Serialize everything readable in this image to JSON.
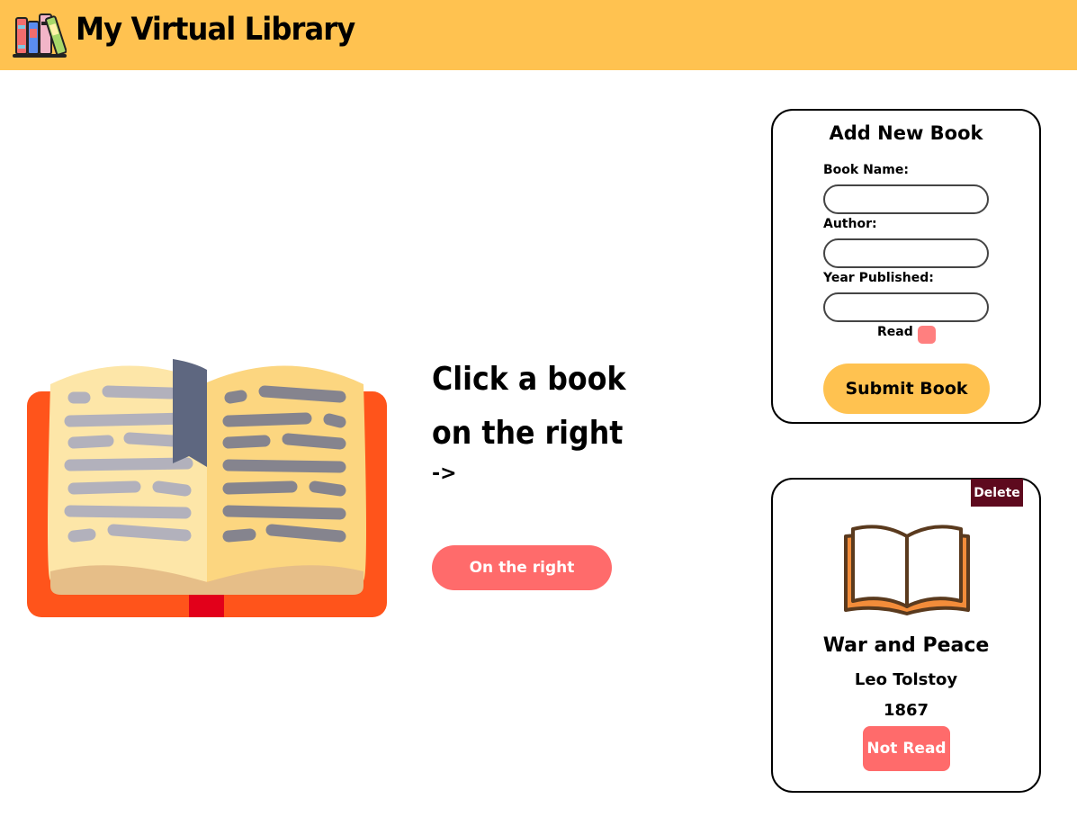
{
  "header": {
    "title": "My Virtual Library",
    "logo_icon": "bookshelf-icon",
    "background": "#ffc250"
  },
  "hero": {
    "image_icon": "open-book-icon",
    "line1": "Click a book",
    "line2": "on the right",
    "arrow": "->",
    "button_label": "On the right"
  },
  "form": {
    "title": "Add New Book",
    "book_name_label": "Book Name:",
    "book_name_value": "",
    "author_label": "Author:",
    "author_value": "",
    "year_label": "Year Published:",
    "year_value": "",
    "read_label": "Read",
    "read_checked": false,
    "submit_label": "Submit Book"
  },
  "book_card": {
    "delete_label": "Delete",
    "icon": "book-outline-icon",
    "title": "War and Peace",
    "author": "Leo Tolstoy",
    "year": "1867",
    "status_label": "Not Read"
  },
  "colors": {
    "accent": "#ffc250",
    "coral": "#ff6b6b",
    "delete": "#5e0a1e"
  }
}
